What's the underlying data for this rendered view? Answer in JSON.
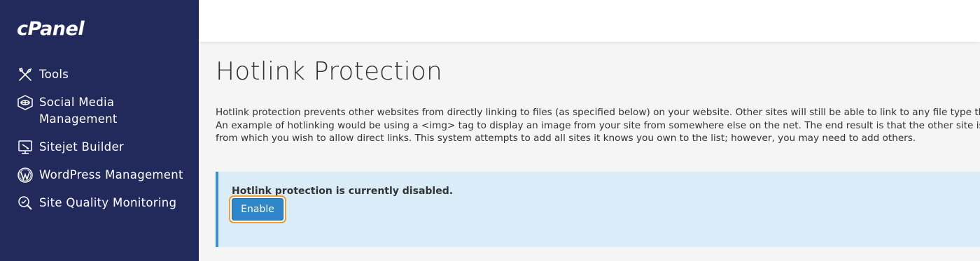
{
  "app": {
    "logo": "cPanel"
  },
  "sidebar": {
    "items": [
      {
        "label": "Tools",
        "icon": "tools-icon"
      },
      {
        "label": "Social Media Management",
        "line1": "Social Media",
        "line2": "Management",
        "icon": "social-media-icon"
      },
      {
        "label": "Sitejet Builder",
        "icon": "sitejet-icon"
      },
      {
        "label": "WordPress Management",
        "icon": "wordpress-icon"
      },
      {
        "label": "Site Quality Monitoring",
        "icon": "site-quality-icon"
      }
    ]
  },
  "main": {
    "title": "Hotlink Protection",
    "description": {
      "line1": "Hotlink protection prevents other websites from directly linking to files (as specified below) on your website. Other sites will still be able to link to any file type that you d",
      "line2": "An example of hotlinking would be using a <img> tag to display an image from your site from somewhere else on the net. The end result is that the other site is stealing",
      "line3": "from which you wish to allow direct links. This system attempts to add all sites it knows you own to the list; however, you may need to add others."
    },
    "alert": {
      "message": "Hotlink protection is currently disabled.",
      "button_label": "Enable"
    }
  },
  "colors": {
    "sidebar_bg": "#222a5c",
    "accent": "#2f86c9",
    "alert_bg": "#d9ecf7",
    "alert_border": "#3b8fd0",
    "focus_ring": "#f0a030"
  }
}
